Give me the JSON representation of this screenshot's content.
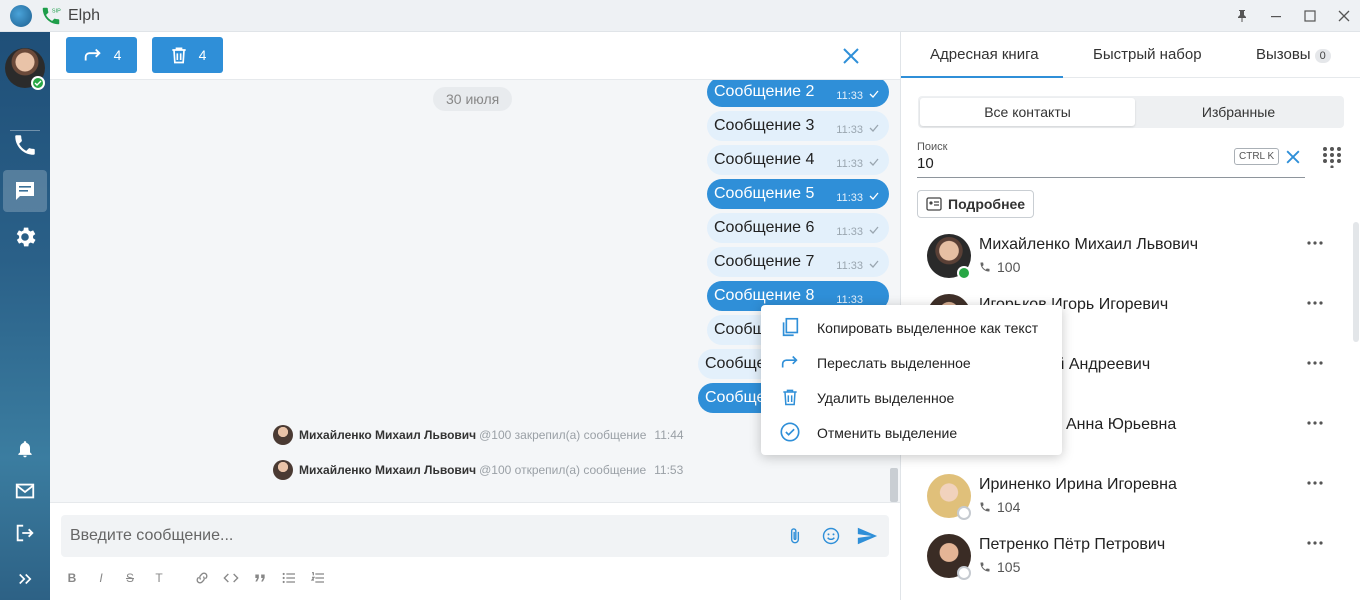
{
  "titlebar": {
    "app_title": "Elph",
    "sip_label": "SIP"
  },
  "colors": {
    "accent": "#2f8fd8",
    "online": "#28a745",
    "rail": "#2a6088"
  },
  "chat": {
    "forward_count": "4",
    "delete_count": "4",
    "date_chip": "30 июля",
    "messages": [
      {
        "text": "Сообщение 2",
        "time": "11:33",
        "selected": true
      },
      {
        "text": "Сообщение 3",
        "time": "11:33",
        "selected": false
      },
      {
        "text": "Сообщение 4",
        "time": "11:33",
        "selected": false
      },
      {
        "text": "Сообщение 5",
        "time": "11:33",
        "selected": true
      },
      {
        "text": "Сообщение 6",
        "time": "11:33",
        "selected": false
      },
      {
        "text": "Сообщение 7",
        "time": "11:33",
        "selected": false
      },
      {
        "text": "Сообщение 8",
        "time": "11:33",
        "selected": true
      },
      {
        "text": "Сообщ",
        "selected": false
      },
      {
        "text": "Сообще",
        "selected": false
      },
      {
        "text": "Сообще",
        "selected": true
      }
    ],
    "system_events": [
      {
        "name": "Михайленко Михаил Львович",
        "action": "@100 закрепил(а) сообщение",
        "time": "11:44"
      },
      {
        "name": "Михайленко Михаил Львович",
        "action": "@100 открепил(а) сообщение",
        "time": "11:53"
      }
    ],
    "input_placeholder": "Введите сообщение...",
    "format_buttons": [
      "B",
      "I",
      "S",
      "T"
    ]
  },
  "context_menu": {
    "items": [
      {
        "label": "Копировать выделенное как текст",
        "icon": "copy-icon"
      },
      {
        "label": "Переслать выделенное",
        "icon": "forward-icon"
      },
      {
        "label": "Удалить выделенное",
        "icon": "trash-icon"
      },
      {
        "label": "Отменить выделение",
        "icon": "check-circle-icon"
      }
    ]
  },
  "right_panel": {
    "tabs": [
      {
        "label": "Адресная книга"
      },
      {
        "label": "Быстрый набор"
      },
      {
        "label": "Вызовы",
        "count": "0"
      }
    ],
    "segments": [
      "Все контакты",
      "Избранные"
    ],
    "search": {
      "label": "Поиск",
      "value": "10",
      "shortcut": "CTRL K"
    },
    "more_button": "Подробнее",
    "contacts": [
      {
        "name": "Михайленко Михаил Львович",
        "ext": "100",
        "status": "online"
      },
      {
        "name": "Игорьков Игорь Игоревич",
        "ext": "",
        "status": ""
      },
      {
        "name": "ко Дмитрий Андреевич",
        "ext": "",
        "status": ""
      },
      {
        "name": "Анна Юрьевна",
        "ext": "",
        "status": ""
      },
      {
        "name": "Ириненко Ирина Игоревна",
        "ext": "104",
        "status": "offline"
      },
      {
        "name": "Петренко Пётр Петрович",
        "ext": "105",
        "status": "offline"
      }
    ]
  }
}
